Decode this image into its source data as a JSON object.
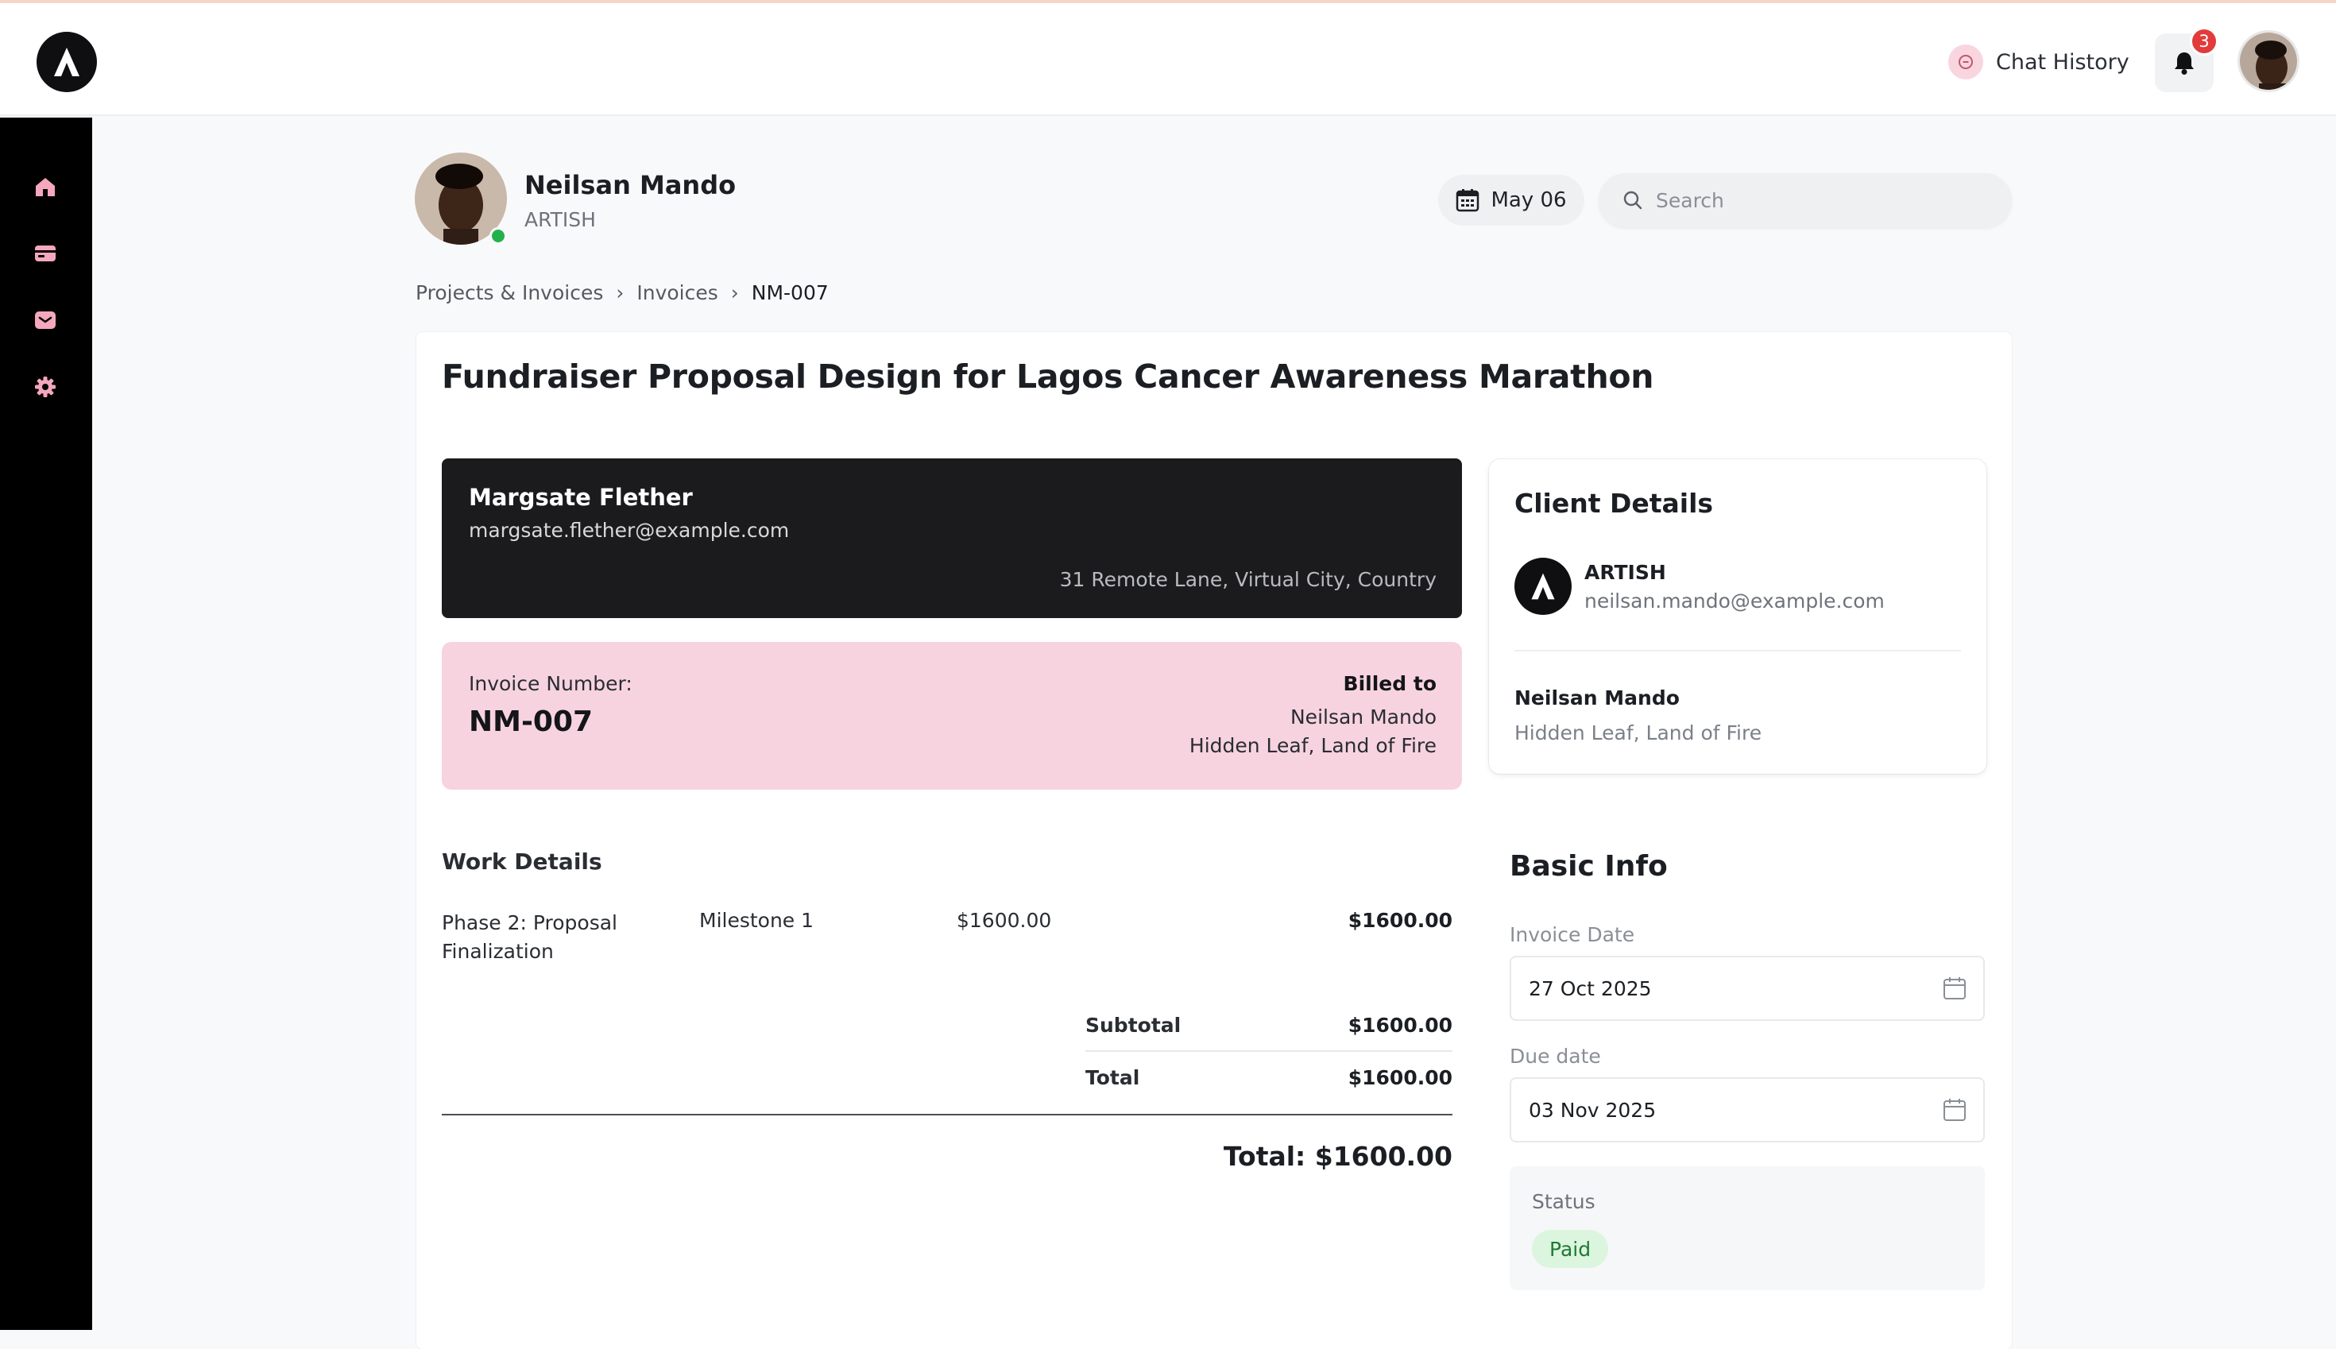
{
  "header": {
    "chat_history_label": "Chat History",
    "notification_count": "3"
  },
  "profile": {
    "name": "Neilsan Mando",
    "role": "ARTISH",
    "date": "May 06"
  },
  "search": {
    "placeholder": "Search",
    "value": ""
  },
  "breadcrumb": {
    "items": [
      "Projects & Invoices",
      "Invoices"
    ],
    "separator": "›",
    "current": "NM-007"
  },
  "invoice": {
    "title": "Fundraiser Proposal Design for Lagos Cancer Awareness Marathon",
    "sender": {
      "name": "Margsate Flether",
      "email": "margsate.flether@example.com",
      "address": "31 Remote Lane, Virtual City, Country"
    },
    "number_label": "Invoice Number:",
    "number": "NM-007",
    "billed_to_label": "Billed to",
    "billed_to_name": "Neilsan Mando",
    "billed_to_address": "Hidden Leaf, Land of Fire"
  },
  "work": {
    "title": "Work Details",
    "items": [
      {
        "description": "Phase 2: Proposal Finalization",
        "milestone": "Milestone 1",
        "rate": "$1600.00",
        "amount": "$1600.00"
      }
    ],
    "subtotal_label": "Subtotal",
    "subtotal": "$1600.00",
    "total_label": "Total",
    "total": "$1600.00",
    "grand_total": "Total: $1600.00"
  },
  "client": {
    "title": "Client Details",
    "org": "ARTISH",
    "email": "neilsan.mando@example.com",
    "person": "Neilsan Mando",
    "address": "Hidden Leaf, Land of Fire"
  },
  "basic_info": {
    "title": "Basic Info",
    "invoice_date_label": "Invoice Date",
    "invoice_date": "27 Oct 2025",
    "due_date_label": "Due date",
    "due_date": "03 Nov 2025",
    "status_label": "Status",
    "status": "Paid"
  },
  "sidebar": {
    "items": [
      {
        "icon": "home-icon"
      },
      {
        "icon": "card-icon"
      },
      {
        "icon": "inbox-icon"
      },
      {
        "icon": "gear-icon"
      }
    ]
  },
  "colors": {
    "accent_pink": "#f7d3e0",
    "sender_bg": "#1b1b1d",
    "status_paid_bg": "#dcf5df",
    "status_paid_text": "#1f7a34",
    "badge_red": "#e23b3b",
    "sidebar_bg": "#000000"
  }
}
